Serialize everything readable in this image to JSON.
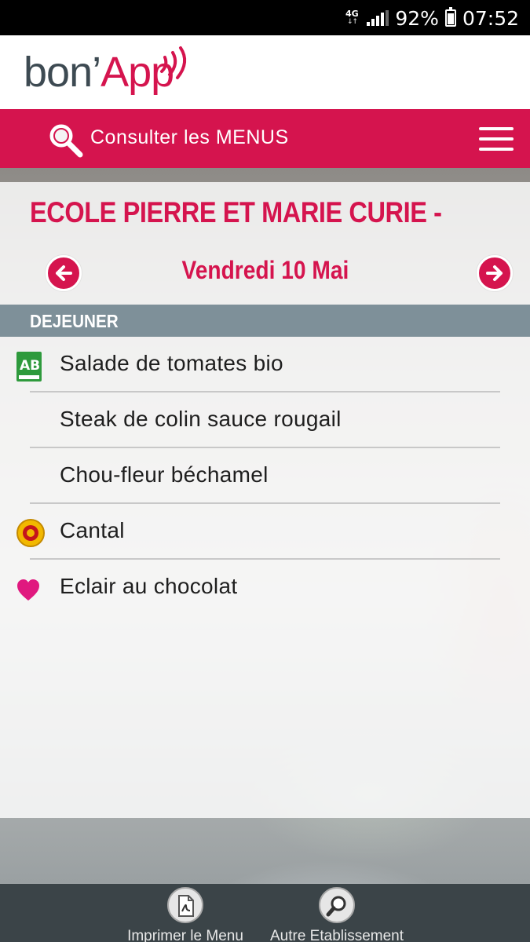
{
  "status_bar": {
    "network": "4G",
    "battery": "92%",
    "time": "07:52"
  },
  "header": {
    "logo_left": "bon’",
    "logo_right": "App"
  },
  "menu_bar": {
    "consult_label": "Consulter les MENUS"
  },
  "school": {
    "name": "ECOLE PIERRE ET MARIE CURIE -"
  },
  "date_nav": {
    "date": "Vendredi 10 Mai"
  },
  "meal": {
    "title": "DEJEUNER",
    "items": [
      {
        "label": "Salade de tomates bio",
        "badge": "ab-bio-icon"
      },
      {
        "label": "Steak de colin sauce rougail",
        "badge": ""
      },
      {
        "label": "Chou-fleur béchamel",
        "badge": ""
      },
      {
        "label": "Cantal",
        "badge": "aop-label-icon"
      },
      {
        "label": "Eclair au chocolat",
        "badge": "heart-icon"
      }
    ]
  },
  "footer": {
    "print_label": "Imprimer le Menu",
    "other_label": "Autre Etablissement"
  },
  "colors": {
    "brand_red": "#d5144e",
    "header_grey": "#7e9099",
    "footer_bg": "#3b4448"
  }
}
